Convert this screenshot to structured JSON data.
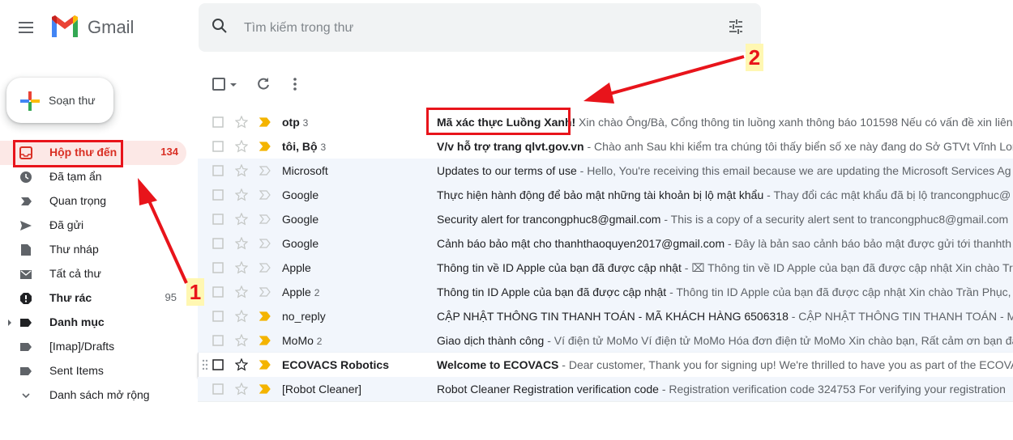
{
  "header": {
    "app_name": "Gmail",
    "search_placeholder": "Tìm kiếm trong thư"
  },
  "compose": {
    "label": "Soạn thư"
  },
  "sidebar": {
    "items": [
      {
        "label": "Hộp thư đến",
        "count": "134"
      },
      {
        "label": "Đã tạm ẩn"
      },
      {
        "label": "Quan trọng"
      },
      {
        "label": "Đã gửi"
      },
      {
        "label": "Thư nháp"
      },
      {
        "label": "Tất cả thư"
      },
      {
        "label": "Thư rác",
        "count": "95"
      },
      {
        "label": "Danh mục"
      },
      {
        "label": "[Imap]/Drafts"
      },
      {
        "label": "Sent Items"
      },
      {
        "label": "Danh sách mở rộng"
      }
    ]
  },
  "emails": [
    {
      "sender": "otp",
      "count": "3",
      "subject": "Mã xác thực Luồng Xanh!",
      "snippet": " Xin chào Ông/Bà, Cổng thông tin luồng xanh thông báo 101598 Nếu có vấn đề xin liên"
    },
    {
      "sender": "tôi, Bộ",
      "count": "3",
      "subject": "V/v hỗ trợ trang qlvt.gov.vn",
      "snippet": " - Chào anh Sau khi kiểm tra chúng tôi thấy biển số xe này đang do Sở GTVt Vĩnh Long"
    },
    {
      "sender": "Microsoft",
      "count": "",
      "subject": "Updates to our terms of use",
      "snippet": " - Hello, You're receiving this email because we are updating the Microsoft Services Ag"
    },
    {
      "sender": "Google",
      "count": "",
      "subject": "Thực hiện hành động để bảo mật những tài khoản bị lộ mật khẩu",
      "snippet": " - Thay đổi các mật khẩu đã bị lộ trancongphuc@"
    },
    {
      "sender": "Google",
      "count": "",
      "subject": "Security alert for trancongphuc8@gmail.com",
      "snippet": " - This is a copy of a security alert sent to trancongphuc8@gmail.com"
    },
    {
      "sender": "Google",
      "count": "",
      "subject": "Cảnh báo bảo mật cho thanhthaoquyen2017@gmail.com",
      "snippet": " - Đây là bản sao cảnh báo bảo mật được gửi tới thanhth"
    },
    {
      "sender": "Apple",
      "count": "",
      "subject": "Thông tin về ID Apple của bạn đã được cập nhật",
      "snippet": " - ⌧ Thông tin về ID Apple của bạn đã được cập nhật Xin chào Trầ"
    },
    {
      "sender": "Apple",
      "count": "2",
      "subject": "Thông tin ID Apple của bạn đã được cập nhật",
      "snippet": " - Thông tin ID Apple của bạn đã được cập nhật Xin chào Trần Phục,"
    },
    {
      "sender": "no_reply",
      "count": "",
      "subject": "CẬP NHẬT THÔNG TIN THANH TOÁN - MÃ KHÁCH HÀNG 6506318",
      "snippet": " - CẬP NHẬT THÔNG TIN THANH TOÁN - MÃ K"
    },
    {
      "sender": "MoMo",
      "count": "2",
      "subject": "Giao dịch thành công",
      "snippet": " - Ví điện tử MoMo Ví điện tử MoMo Hóa đơn điện tử MoMo Xin chào bạn, Rất cảm ơn bạn đã"
    },
    {
      "sender": "ECOVACS Robotics",
      "count": "",
      "subject": "Welcome to ECOVACS",
      "snippet": " - Dear customer, Thank you for signing up! We're thrilled to have you as part of the ECOVAC"
    },
    {
      "sender": "[Robot Cleaner]",
      "count": "",
      "subject": "Robot Cleaner Registration verification code",
      "snippet": " - Registration verification code 324753 For verifying your registration"
    }
  ],
  "annotations": {
    "label1": "1",
    "label2": "2"
  },
  "colors": {
    "accent_red": "#d93025",
    "annotation_red": "#e8141b",
    "important_yellow": "#f4b400"
  }
}
